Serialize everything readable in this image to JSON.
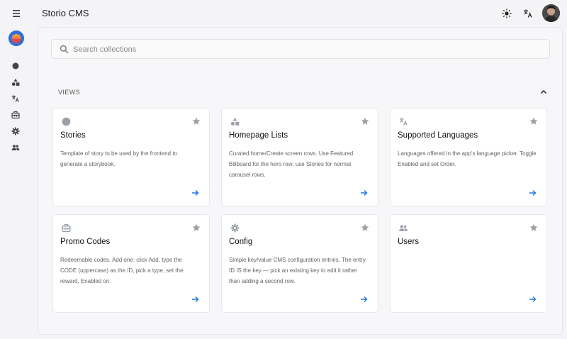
{
  "header": {
    "title": "Storio CMS",
    "icons": [
      "menu-icon",
      "theme-light-icon",
      "translate-icon",
      "avatar"
    ]
  },
  "sidebar": {
    "items": [
      {
        "icon": "circle-icon"
      },
      {
        "icon": "shapes-icon"
      },
      {
        "icon": "translate-icon"
      },
      {
        "icon": "ticket-icon"
      },
      {
        "icon": "gear-icon"
      },
      {
        "icon": "people-icon"
      }
    ]
  },
  "search": {
    "placeholder": "Search collections"
  },
  "section": {
    "label": "VIEWS"
  },
  "cards": [
    {
      "icon": "circle-icon",
      "title": "Stories",
      "description": "Template of story to be used by the frontend to generate a storybook."
    },
    {
      "icon": "shapes-icon",
      "title": "Homepage Lists",
      "description": "Curated home/Create screen rows. Use Featured Billboard for the hero row; use Stories for normal carousel rows."
    },
    {
      "icon": "translate-icon",
      "title": "Supported Languages",
      "description": "Languages offered in the app's language picker. Toggle Enabled and set Order."
    },
    {
      "icon": "ticket-icon",
      "title": "Promo Codes",
      "description": "Redeemable codes. Add one: click Add, type the CODE (uppercase) as the ID, pick a type, set the reward, Enabled on."
    },
    {
      "icon": "gear-icon",
      "title": "Config",
      "description": "Simple key/value CMS configuration entries. The entry ID IS the key — pick an existing key to edit it rather than adding a second row."
    },
    {
      "icon": "people-icon",
      "title": "Users",
      "description": ""
    }
  ],
  "colors": {
    "accent": "#1a73e8",
    "icon_grey": "#9aa0a6",
    "logo_blue": "#2f6fdb"
  }
}
